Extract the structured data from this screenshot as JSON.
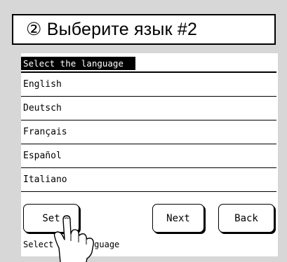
{
  "title": "② Выберите язык #2",
  "screen": {
    "header": "Select the language",
    "languages": [
      "English",
      "Deutsch",
      "Français",
      "Español",
      "Italiano"
    ],
    "buttons": {
      "set": "Set",
      "next": "Next",
      "back": "Back"
    },
    "status": "Select the language"
  },
  "icons": {
    "pointer": "hand-pointer-icon"
  }
}
